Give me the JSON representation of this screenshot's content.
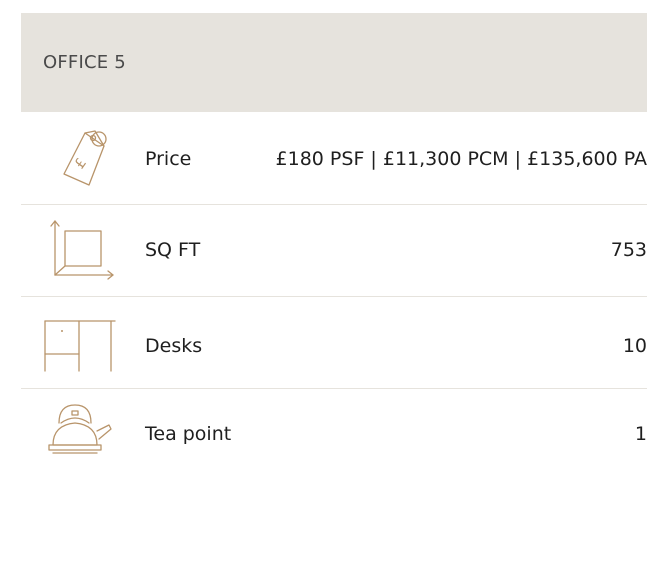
{
  "header": {
    "title": "OFFICE 5"
  },
  "colors": {
    "header_bg": "#e6e3dd",
    "icon_stroke": "#b8946a",
    "divider": "#e6e3dd",
    "text": "#1f1f1f"
  },
  "rows": [
    {
      "icon": "price-tag-icon",
      "label": "Price",
      "value": "£180 PSF | £11,300 PCM | £135,600 PA"
    },
    {
      "icon": "floor-area-icon",
      "label": "SQ FT",
      "value": "753"
    },
    {
      "icon": "desk-icon",
      "label": "Desks",
      "value": "10"
    },
    {
      "icon": "kettle-icon",
      "label": "Tea point",
      "value": "1"
    }
  ]
}
